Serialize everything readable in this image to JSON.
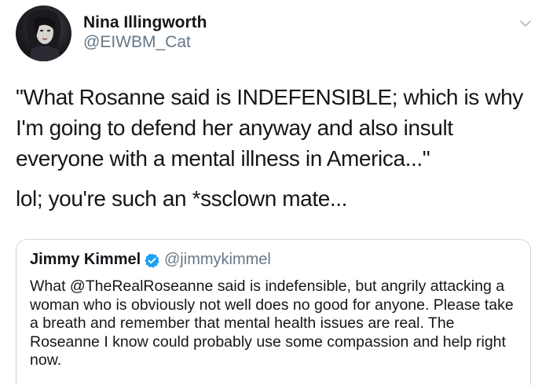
{
  "author": {
    "name": "Nina Illingworth",
    "handle": "@EIWBM_Cat",
    "avatar_icon": "profile-avatar"
  },
  "menu_icon": "chevron-down-icon",
  "tweet": {
    "paragraphs": [
      "\"What Rosanne said is INDEFENSIBLE; which is why I'm going to defend her anyway and also insult everyone with a mental illness in America...\"",
      "lol; you're such an *ssclown mate..."
    ]
  },
  "quoted_tweet": {
    "name": "Jimmy Kimmel",
    "handle": "@jimmykimmel",
    "verified_icon": "verified-badge-icon",
    "text": "What @TheRealRoseanne said is indefensible, but angrily attacking a woman who is obviously not well does no good for anyone.  Please take a breath and remember that mental health issues are real.  The Roseanne I know could probably use some compassion and help right now."
  },
  "colors": {
    "text": "#14171a",
    "secondary": "#657786",
    "border": "#cfd9de",
    "verified": "#1da1f2"
  }
}
